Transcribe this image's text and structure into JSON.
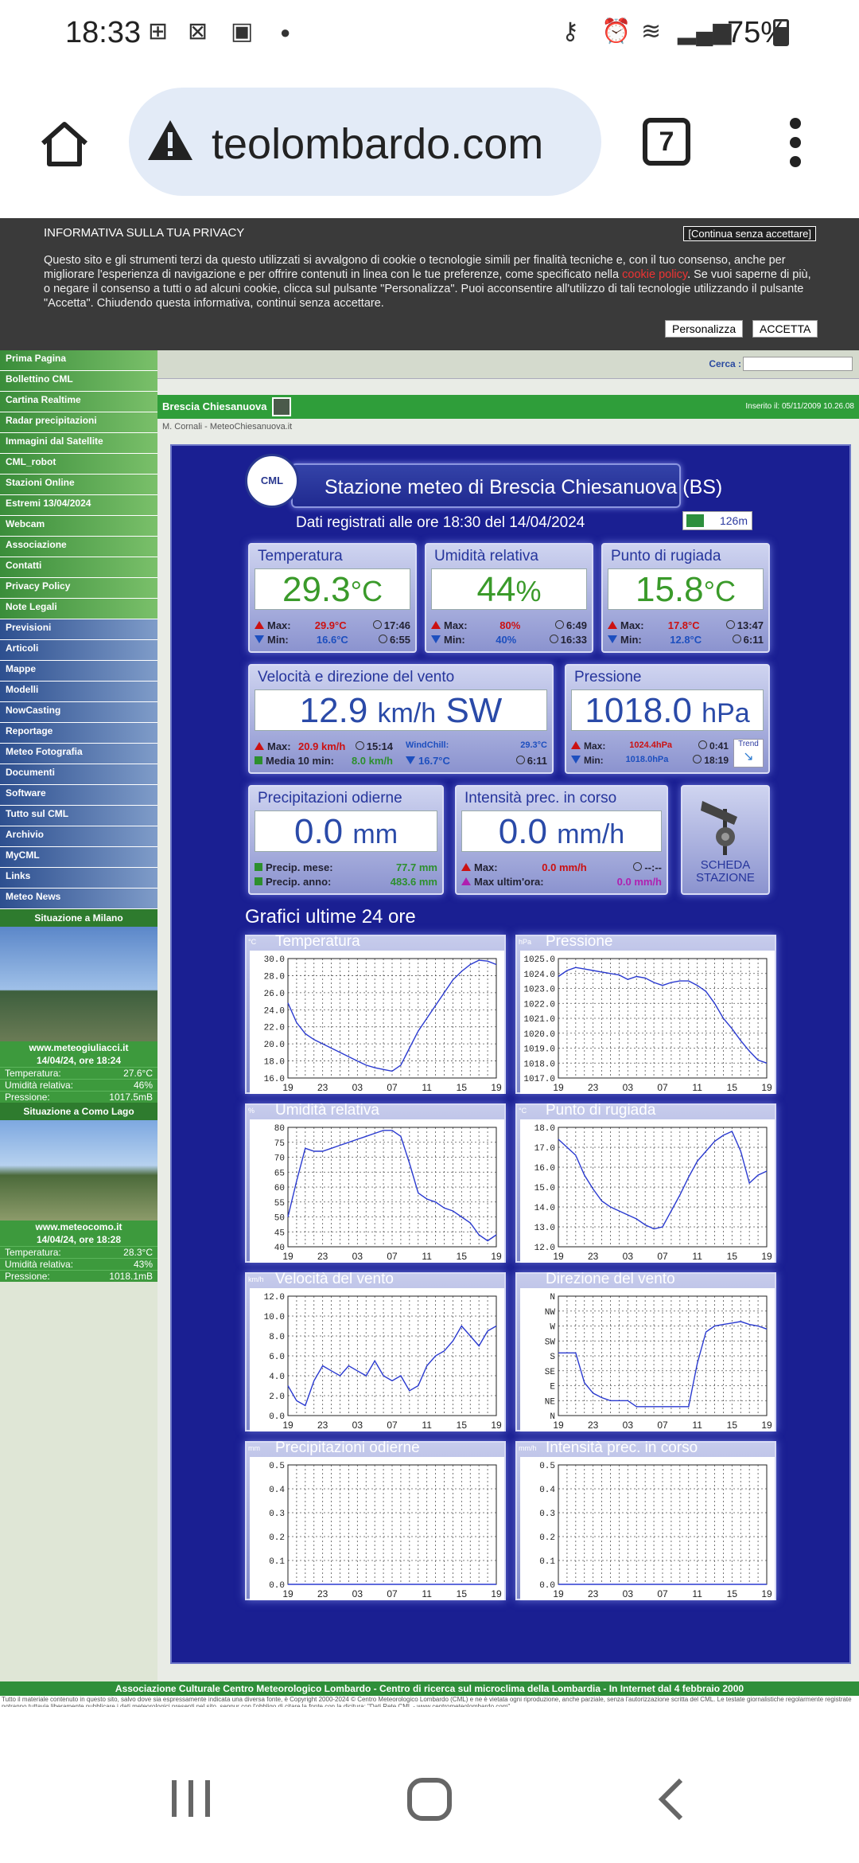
{
  "status": {
    "time": "18:33",
    "battery": "75%"
  },
  "browser": {
    "url": "teolombardo.com",
    "tab_count": "7"
  },
  "privacy": {
    "title": "INFORMATIVA SULLA TUA PRIVACY",
    "continue": "[Continua senza accettare]",
    "text_before": "Questo sito e gli strumenti terzi da questo utilizzati si avvalgono di cookie o tecnologie simili per finalità tecniche e, con il tuo consenso, anche per migliorare l'esperienza di navigazione e per offrire contenuti in linea con le tue preferenze, come specificato nella ",
    "link": "cookie policy",
    "text_after": ". Se vuoi saperne di più, o negare il consenso a tutti o ad alcuni cookie, clicca sul pulsante \"Personalizza\". Puoi acconsentire all'utilizzo di tali tecnologie utilizzando il pulsante \"Accetta\". Chiudendo questa informativa, continui senza accettare.",
    "btn_custom": "Personalizza",
    "btn_accept": "ACCETTA"
  },
  "nav_green": [
    "Prima Pagina",
    "Bollettino CML",
    "Cartina Realtime",
    "Radar precipitazioni",
    "Immagini dal Satellite",
    "CML_robot",
    "Stazioni Online",
    "Estremi 13/04/2024",
    "Webcam",
    "Associazione",
    "Contatti",
    "Privacy Policy",
    "Note Legali"
  ],
  "nav_blue": [
    "Previsioni",
    "Articoli",
    "Mappe",
    "Modelli",
    "NowCasting",
    "Reportage",
    "Meteo Fotografia",
    "Documenti",
    "Software",
    "Tutto sul CML",
    "Archivio",
    "MyCML",
    "Links",
    "Meteo News"
  ],
  "milano": {
    "header": "Situazione a Milano",
    "site": "www.meteogiuliacci.it",
    "date": "14/04/24, ore 18:24",
    "rows": [
      [
        "Temperatura:",
        "27.6°C"
      ],
      [
        "Umidità relativa:",
        "46%"
      ],
      [
        "Pressione:",
        "1017.5mB"
      ]
    ]
  },
  "como": {
    "header": "Situazione a Como Lago",
    "site": "www.meteocomo.it",
    "date": "14/04/24, ore 18:28",
    "rows": [
      [
        "Temperatura:",
        "28.3°C"
      ],
      [
        "Umidità relativa:",
        "43%"
      ],
      [
        "Pressione:",
        "1018.1mB"
      ]
    ]
  },
  "search": {
    "label": "Cerca :"
  },
  "station": {
    "name": "Brescia Chiesanuova",
    "inserted": "Inserito il: 05/11/2009 10.26.08",
    "credit": "M. Cornali - MeteoChiesanuova.it"
  },
  "panel": {
    "title": "Stazione meteo di Brescia Chiesanuova (BS)",
    "logo": "CML",
    "subtitle": "Dati registrati alle ore 18:30 del 14/04/2024",
    "altitude": "126m",
    "charts_title": "Grafici ultime 24 ore"
  },
  "temp": {
    "label": "Temperatura",
    "value": "29.3",
    "unit": "°C",
    "max": "29.9°C",
    "max_time": "17:46",
    "min": "16.6°C",
    "min_time": "6:55"
  },
  "hum": {
    "label": "Umidità relativa",
    "value": "44",
    "unit": "%",
    "max": "80%",
    "max_time": "6:49",
    "min": "40%",
    "min_time": "16:33"
  },
  "dew": {
    "label": "Punto di rugiada",
    "value": "15.8",
    "unit": "°C",
    "max": "17.8°C",
    "max_time": "13:47",
    "min": "12.8°C",
    "min_time": "6:11"
  },
  "wind": {
    "label": "Velocità e direzione del vento",
    "value": "12.9",
    "unit": "km/h",
    "dir": "SW",
    "max": "20.9 km/h",
    "max_time": "15:14",
    "avg_label": "Media 10 min:",
    "avg": "8.0 km/h",
    "wc_label": "WindChill:",
    "wc": "29.3°C",
    "wc_min": "16.7°C",
    "wc_time": "6:11"
  },
  "press": {
    "label": "Pressione",
    "value": "1018.0",
    "unit": "hPa",
    "max": "1024.4hPa",
    "max_time": "0:41",
    "min": "1018.0hPa",
    "min_time": "18:19",
    "trend": "Trend"
  },
  "rain": {
    "label": "Precipitazioni odierne",
    "value": "0.0",
    "unit": "mm",
    "month_label": "Precip. mese:",
    "month": "77.7 mm",
    "year_label": "Precip. anno:",
    "year": "483.6 mm"
  },
  "rate": {
    "label": "Intensità prec. in corso",
    "value": "0.0",
    "unit": "mm/h",
    "max_label": "Max:",
    "max": "0.0 mm/h",
    "max_time": "--:--",
    "hour_label": "Max ultim'ora:",
    "hour": "0.0 mm/h"
  },
  "scheda": {
    "label1": "SCHEDA",
    "label2": "STAZIONE"
  },
  "labels": {
    "max": "Max:",
    "min": "Min:"
  },
  "footer": {
    "bar": "Associazione Culturale Centro Meteorologico Lombardo - Centro di ricerca sul microclima della Lombardia - In Internet dal 4 febbraio 2000",
    "fine": "Tutto il materiale contenuto in questo sito, salvo dove sia espressamente indicata una diversa fonte, è Copyright 2000-2024 © Centro Meteorologico Lombardo (CML) e ne è vietata ogni riproduzione, anche parziale, senza l'autorizzazione scritta del CML. Le testate giornalistiche regolarmente registrate potranno tuttavia liberamente pubblicare i dati meteorologici presenti nel sito, seppur con l'obbligo di citare la fonte con la dicitura: \"Dati Rete CML - www.centrometeolombardo.com\"."
  },
  "chart_data": [
    {
      "type": "line",
      "title": "Temperatura",
      "unit": "°C",
      "x_ticks": [
        "19",
        "23",
        "03",
        "07",
        "11",
        "15",
        "19"
      ],
      "ylim": [
        16,
        30
      ],
      "y_ticks": [
        "30.0",
        "28.0",
        "26.0",
        "24.0",
        "22.0",
        "20.0",
        "18.0",
        "16.0"
      ],
      "x": [
        0,
        1,
        2,
        3,
        4,
        5,
        6,
        7,
        8,
        9,
        10,
        11,
        12,
        13,
        14,
        15,
        16,
        17,
        18,
        19,
        20,
        21,
        22,
        23,
        24
      ],
      "values": [
        24.8,
        22.5,
        21.2,
        20.5,
        20.0,
        19.5,
        19.0,
        18.5,
        18.0,
        17.5,
        17.2,
        17.0,
        16.8,
        17.5,
        19.5,
        21.5,
        23.0,
        24.5,
        26.0,
        27.5,
        28.5,
        29.3,
        29.8,
        29.7,
        29.3
      ]
    },
    {
      "type": "line",
      "title": "Pressione",
      "unit": "hPa",
      "x_ticks": [
        "19",
        "23",
        "03",
        "07",
        "11",
        "15",
        "19"
      ],
      "ylim": [
        1017,
        1025
      ],
      "y_ticks": [
        "1025.0",
        "1024.0",
        "1023.0",
        "1022.0",
        "1021.0",
        "1020.0",
        "1019.0",
        "1018.0",
        "1017.0"
      ],
      "x": [
        0,
        1,
        2,
        3,
        4,
        5,
        6,
        7,
        8,
        9,
        10,
        11,
        12,
        13,
        14,
        15,
        16,
        17,
        18,
        19,
        20,
        21,
        22,
        23,
        24
      ],
      "values": [
        1023.8,
        1024.2,
        1024.4,
        1024.3,
        1024.2,
        1024.1,
        1024.0,
        1023.9,
        1023.6,
        1023.8,
        1023.7,
        1023.4,
        1023.2,
        1023.4,
        1023.5,
        1023.5,
        1023.2,
        1022.8,
        1022.0,
        1021.0,
        1020.3,
        1019.5,
        1018.8,
        1018.2,
        1018.0
      ]
    },
    {
      "type": "line",
      "title": "Umidità relativa",
      "unit": "%",
      "x_ticks": [
        "19",
        "23",
        "03",
        "07",
        "11",
        "15",
        "19"
      ],
      "ylim": [
        40,
        80
      ],
      "y_ticks": [
        "80",
        "75",
        "70",
        "65",
        "60",
        "55",
        "50",
        "45",
        "40"
      ],
      "x": [
        0,
        1,
        2,
        3,
        4,
        5,
        6,
        7,
        8,
        9,
        10,
        11,
        12,
        13,
        14,
        15,
        16,
        17,
        18,
        19,
        20,
        21,
        22,
        23,
        24
      ],
      "values": [
        50,
        62,
        73,
        72,
        72,
        73,
        74,
        75,
        76,
        77,
        78,
        79,
        79,
        77,
        68,
        58,
        56,
        55,
        53,
        52,
        50,
        48,
        44,
        42,
        44
      ]
    },
    {
      "type": "line",
      "title": "Punto di rugiada",
      "unit": "°C",
      "x_ticks": [
        "19",
        "23",
        "03",
        "07",
        "11",
        "15",
        "19"
      ],
      "ylim": [
        12,
        18
      ],
      "y_ticks": [
        "18.0",
        "17.0",
        "16.0",
        "15.0",
        "14.0",
        "13.0",
        "12.0"
      ],
      "x": [
        0,
        1,
        2,
        3,
        4,
        5,
        6,
        7,
        8,
        9,
        10,
        11,
        12,
        13,
        14,
        15,
        16,
        17,
        18,
        19,
        20,
        21,
        22,
        23,
        24
      ],
      "values": [
        17.4,
        17.0,
        16.6,
        15.6,
        14.9,
        14.3,
        14.0,
        13.8,
        13.6,
        13.4,
        13.1,
        12.9,
        13.0,
        13.8,
        14.6,
        15.5,
        16.3,
        16.8,
        17.3,
        17.6,
        17.8,
        16.8,
        15.2,
        15.6,
        15.8
      ]
    },
    {
      "type": "line",
      "title": "Velocità del vento",
      "unit": "km/h",
      "x_ticks": [
        "19",
        "23",
        "03",
        "07",
        "11",
        "15",
        "19"
      ],
      "ylim": [
        0,
        12
      ],
      "y_ticks": [
        "12.0",
        "10.0",
        "8.0",
        "6.0",
        "4.0",
        "2.0",
        "0.0"
      ],
      "x": [
        0,
        1,
        2,
        3,
        4,
        5,
        6,
        7,
        8,
        9,
        10,
        11,
        12,
        13,
        14,
        15,
        16,
        17,
        18,
        19,
        20,
        21,
        22,
        23,
        24
      ],
      "values": [
        3.0,
        1.5,
        1.0,
        3.5,
        5.0,
        4.5,
        4.0,
        5.0,
        4.5,
        4.0,
        5.5,
        4.0,
        3.5,
        4.0,
        2.5,
        3.0,
        5.0,
        6.0,
        6.5,
        7.5,
        9.0,
        8.0,
        7.0,
        8.5,
        9.0
      ]
    },
    {
      "type": "line",
      "title": "Direzione del vento",
      "unit": "",
      "x_ticks": [
        "19",
        "23",
        "03",
        "07",
        "11",
        "15",
        "19"
      ],
      "y_ticks": [
        "N",
        "NW",
        "W",
        "SW",
        "S",
        "SE",
        "E",
        "NE",
        "N"
      ],
      "ylim": [
        0,
        8
      ],
      "x": [
        0,
        1,
        2,
        3,
        4,
        5,
        6,
        7,
        8,
        9,
        10,
        11,
        12,
        13,
        14,
        15,
        16,
        17,
        18,
        19,
        20,
        21,
        22,
        23,
        24
      ],
      "values": [
        4.2,
        4.2,
        4.2,
        2.2,
        1.5,
        1.2,
        1.0,
        1.0,
        1.0,
        0.6,
        0.6,
        0.6,
        0.6,
        0.6,
        0.6,
        0.6,
        3.5,
        5.6,
        6.0,
        6.1,
        6.2,
        6.3,
        6.1,
        6.0,
        5.8
      ]
    },
    {
      "type": "line",
      "title": "Precipitazioni odierne",
      "unit": "mm",
      "x_ticks": [
        "19",
        "23",
        "03",
        "07",
        "11",
        "15",
        "19"
      ],
      "ylim": [
        0,
        0.5
      ],
      "y_ticks": [
        "0.5",
        "0.4",
        "0.3",
        "0.2",
        "0.1",
        "0.0"
      ],
      "x": [
        0,
        24
      ],
      "values": [
        0,
        0
      ]
    },
    {
      "type": "line",
      "title": "Intensità prec. in corso",
      "unit": "mm/h",
      "x_ticks": [
        "19",
        "23",
        "03",
        "07",
        "11",
        "15",
        "19"
      ],
      "ylim": [
        0,
        0.5
      ],
      "y_ticks": [
        "0.5",
        "0.4",
        "0.3",
        "0.2",
        "0.1",
        "0.0"
      ],
      "x": [
        0,
        24
      ],
      "values": [
        0,
        0
      ]
    }
  ]
}
